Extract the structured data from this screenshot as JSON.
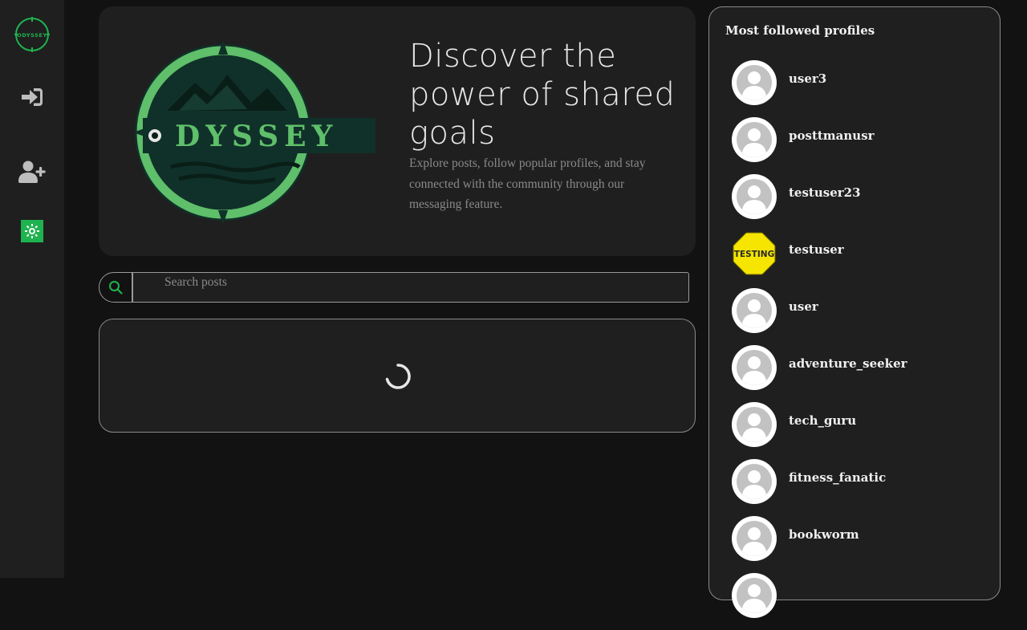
{
  "brand": {
    "logo_text": "ODYSSEY",
    "accent_color": "#1fb34f",
    "logo_green": "#5fbf6a"
  },
  "sidebar": {
    "items": [
      {
        "name": "login",
        "icon": "sign-in-icon"
      },
      {
        "name": "signup",
        "icon": "user-plus-icon"
      },
      {
        "name": "theme-toggle",
        "icon": "sun-icon"
      }
    ]
  },
  "hero": {
    "title": "Discover the power of shared goals",
    "description": "Explore posts, follow popular profiles, and stay connected with the community through our messaging feature."
  },
  "search": {
    "placeholder": "Search posts",
    "value": ""
  },
  "posts": {
    "state": "loading"
  },
  "profiles_panel": {
    "title": "Most followed profiles",
    "profiles": [
      {
        "username": "user3",
        "avatar": "default"
      },
      {
        "username": "posttmanusr",
        "avatar": "default"
      },
      {
        "username": "testuser23",
        "avatar": "default"
      },
      {
        "username": "testuser",
        "avatar": "testing",
        "avatar_text": "TESTING"
      },
      {
        "username": "user",
        "avatar": "default"
      },
      {
        "username": "adventure_seeker",
        "avatar": "default"
      },
      {
        "username": "tech_guru",
        "avatar": "default"
      },
      {
        "username": "fitness_fanatic",
        "avatar": "default"
      },
      {
        "username": "bookworm",
        "avatar": "default"
      }
    ]
  }
}
